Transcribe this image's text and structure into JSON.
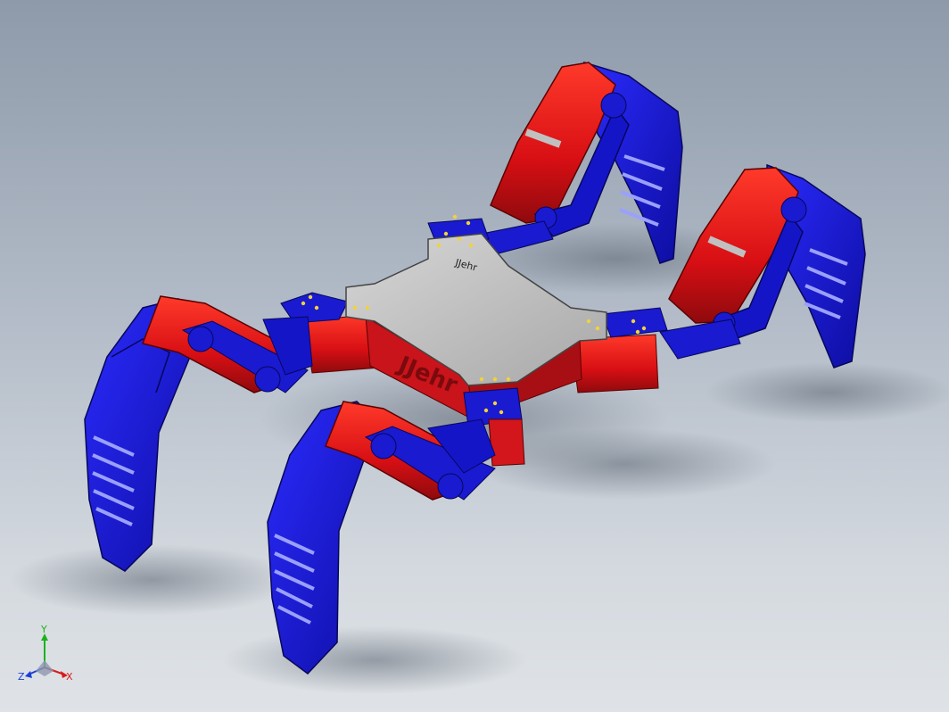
{
  "view": {
    "background_top": "#8e9aaa",
    "background_bottom": "#dfe3e7"
  },
  "model": {
    "engraving": "JJehr",
    "colors": {
      "servo_red": "#e0171b",
      "bracket_blue": "#1a1ad0",
      "plate_gray": "#b8b8b8",
      "screw_yellow": "#f1d23a"
    }
  },
  "triad": {
    "x_label": "X",
    "y_label": "Y",
    "z_label": "Z",
    "x_color": "#d81b1b",
    "y_color": "#19b319",
    "z_color": "#1a3fd6"
  }
}
